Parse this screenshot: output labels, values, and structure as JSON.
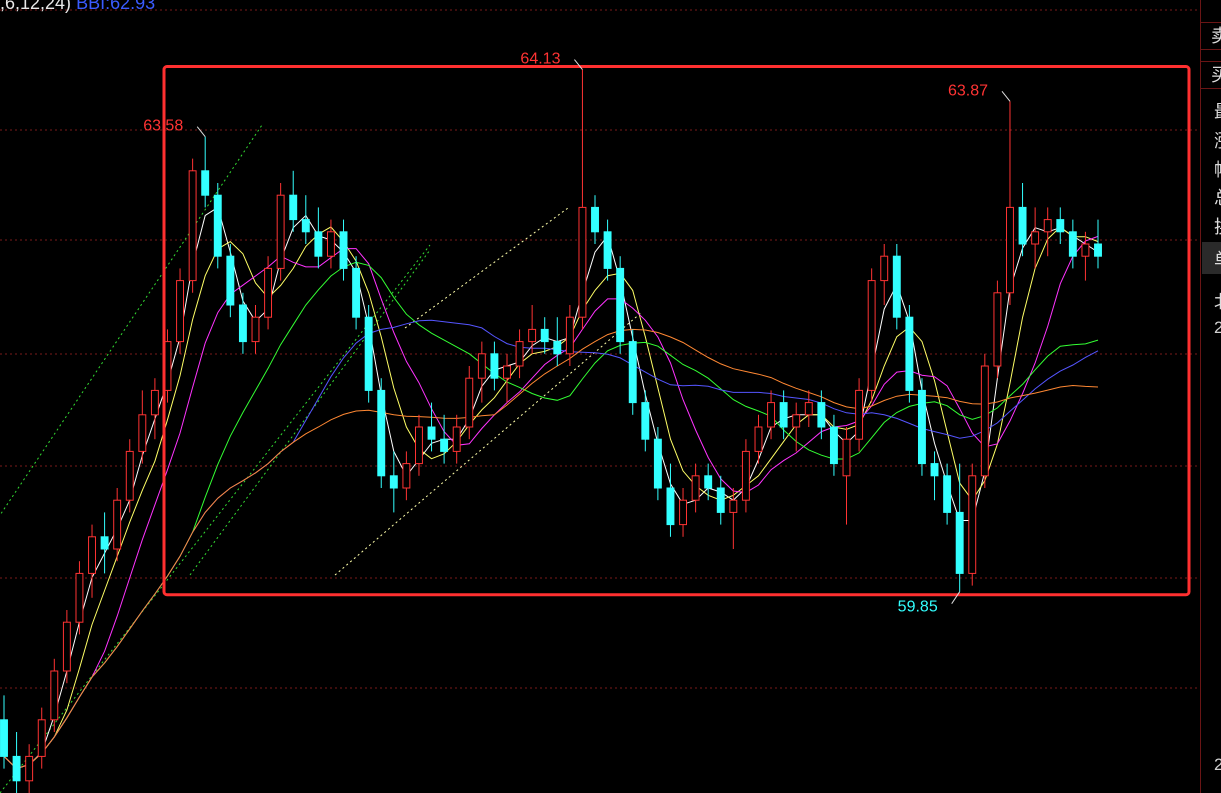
{
  "header": {
    "params_text": ",6,12,24)",
    "bbi_text": "BBI:62.93"
  },
  "colors": {
    "background": "#000000",
    "up": "#ff3333",
    "down": "#33ffff",
    "ma_white": "#ffffff",
    "ma_yellow": "#ffff66",
    "ma_magenta": "#ff33ff",
    "ma_green": "#33ff33",
    "ma_blue": "#5555ff",
    "ma_orange": "#ff8833",
    "highlight_box": "#ff3030",
    "grid": "#7a1a1a"
  },
  "right_panel": {
    "row_chars": [
      "卖",
      "买"
    ],
    "chars": [
      "最",
      "涨",
      "幅",
      "总",
      "换"
    ],
    "dark_char": "单",
    "label_char": "北",
    "numbers": [
      "2",
      "2"
    ]
  },
  "chart_data": {
    "type": "candlestick",
    "price_axis_range": [
      58.2,
      64.7
    ],
    "grid": "horizontal dashed",
    "annotations": [
      {
        "label": "63.58",
        "kind": "local high"
      },
      {
        "label": "64.13",
        "kind": "range high"
      },
      {
        "label": "63.87",
        "kind": "local high"
      },
      {
        "label": "59.85",
        "kind": "range low"
      }
    ],
    "highlight_range": {
      "high": 64.13,
      "low": 59.85
    },
    "ohlc": [
      [
        58.8,
        59.0,
        58.4,
        58.5
      ],
      [
        58.5,
        58.7,
        58.2,
        58.3
      ],
      [
        58.3,
        58.6,
        58.2,
        58.5
      ],
      [
        58.5,
        58.9,
        58.4,
        58.8
      ],
      [
        58.8,
        59.3,
        58.7,
        59.2
      ],
      [
        59.2,
        59.7,
        59.1,
        59.6
      ],
      [
        59.6,
        60.1,
        59.5,
        60.0
      ],
      [
        60.0,
        60.4,
        59.8,
        60.3
      ],
      [
        60.3,
        60.5,
        60.0,
        60.2
      ],
      [
        60.2,
        60.7,
        60.1,
        60.6
      ],
      [
        60.6,
        61.1,
        60.5,
        61.0
      ],
      [
        61.0,
        61.5,
        60.9,
        61.3
      ],
      [
        61.3,
        61.6,
        61.1,
        61.5
      ],
      [
        61.5,
        62.0,
        61.4,
        61.9
      ],
      [
        61.9,
        62.5,
        61.8,
        62.4
      ],
      [
        62.4,
        63.4,
        62.3,
        63.3
      ],
      [
        63.3,
        63.58,
        63.0,
        63.1
      ],
      [
        63.1,
        63.2,
        62.5,
        62.6
      ],
      [
        62.6,
        62.7,
        62.1,
        62.2
      ],
      [
        62.2,
        62.3,
        61.8,
        61.9
      ],
      [
        61.9,
        62.2,
        61.8,
        62.1
      ],
      [
        62.1,
        62.6,
        62.0,
        62.5
      ],
      [
        62.5,
        63.2,
        62.4,
        63.1
      ],
      [
        63.1,
        63.3,
        62.8,
        62.9
      ],
      [
        62.9,
        63.1,
        62.7,
        62.8
      ],
      [
        62.8,
        63.0,
        62.5,
        62.6
      ],
      [
        62.6,
        62.9,
        62.5,
        62.8
      ],
      [
        62.8,
        62.9,
        62.4,
        62.5
      ],
      [
        62.5,
        62.6,
        62.0,
        62.1
      ],
      [
        62.1,
        62.2,
        61.4,
        61.5
      ],
      [
        61.5,
        61.6,
        60.7,
        60.8
      ],
      [
        60.8,
        61.0,
        60.5,
        60.7
      ],
      [
        60.7,
        61.0,
        60.6,
        60.9
      ],
      [
        60.9,
        61.3,
        60.8,
        61.2
      ],
      [
        61.2,
        61.4,
        61.0,
        61.1
      ],
      [
        61.1,
        61.3,
        60.9,
        61.0
      ],
      [
        61.0,
        61.3,
        60.9,
        61.2
      ],
      [
        61.2,
        61.7,
        61.1,
        61.6
      ],
      [
        61.6,
        61.9,
        61.4,
        61.8
      ],
      [
        61.8,
        61.9,
        61.5,
        61.6
      ],
      [
        61.6,
        61.8,
        61.4,
        61.7
      ],
      [
        61.7,
        62.0,
        61.6,
        61.9
      ],
      [
        61.9,
        62.2,
        61.8,
        62.0
      ],
      [
        62.0,
        62.1,
        61.8,
        61.9
      ],
      [
        61.9,
        62.1,
        61.7,
        61.8
      ],
      [
        61.8,
        62.2,
        61.7,
        62.1
      ],
      [
        62.1,
        64.13,
        62.0,
        63.0
      ],
      [
        63.0,
        63.1,
        62.7,
        62.8
      ],
      [
        62.8,
        62.9,
        62.4,
        62.5
      ],
      [
        62.5,
        62.6,
        61.8,
        61.9
      ],
      [
        61.9,
        62.0,
        61.3,
        61.4
      ],
      [
        61.4,
        61.5,
        61.0,
        61.1
      ],
      [
        61.1,
        61.2,
        60.6,
        60.7
      ],
      [
        60.7,
        60.9,
        60.3,
        60.4
      ],
      [
        60.4,
        60.7,
        60.3,
        60.6
      ],
      [
        60.6,
        60.9,
        60.5,
        60.8
      ],
      [
        60.8,
        60.9,
        60.6,
        60.7
      ],
      [
        60.7,
        60.8,
        60.4,
        60.5
      ],
      [
        60.5,
        60.7,
        60.2,
        60.6
      ],
      [
        60.6,
        61.1,
        60.5,
        61.0
      ],
      [
        61.0,
        61.3,
        60.9,
        61.2
      ],
      [
        61.2,
        61.5,
        61.1,
        61.4
      ],
      [
        61.4,
        61.5,
        61.1,
        61.2
      ],
      [
        61.2,
        61.4,
        61.0,
        61.3
      ],
      [
        61.3,
        61.5,
        61.2,
        61.4
      ],
      [
        61.4,
        61.5,
        61.1,
        61.2
      ],
      [
        61.2,
        61.3,
        60.8,
        60.9
      ],
      [
        60.8,
        61.2,
        60.4,
        61.1
      ],
      [
        61.1,
        61.6,
        61.0,
        61.5
      ],
      [
        61.5,
        62.5,
        61.4,
        62.4
      ],
      [
        62.4,
        62.7,
        62.2,
        62.6
      ],
      [
        62.6,
        62.7,
        62.0,
        62.1
      ],
      [
        62.1,
        62.2,
        61.4,
        61.5
      ],
      [
        61.5,
        61.6,
        60.8,
        60.9
      ],
      [
        60.9,
        61.0,
        60.6,
        60.8
      ],
      [
        60.8,
        60.9,
        60.4,
        60.5
      ],
      [
        60.5,
        60.9,
        59.85,
        60.0
      ],
      [
        60.0,
        60.9,
        59.9,
        60.8
      ],
      [
        60.8,
        61.8,
        60.7,
        61.7
      ],
      [
        61.7,
        62.4,
        61.6,
        62.3
      ],
      [
        62.3,
        63.87,
        62.2,
        63.0
      ],
      [
        63.0,
        63.2,
        62.6,
        62.7
      ],
      [
        62.7,
        63.0,
        62.5,
        62.8
      ],
      [
        62.8,
        63.0,
        62.6,
        62.9
      ],
      [
        62.9,
        63.0,
        62.7,
        62.8
      ],
      [
        62.8,
        62.9,
        62.5,
        62.6
      ],
      [
        62.6,
        62.8,
        62.4,
        62.7
      ],
      [
        62.7,
        62.9,
        62.5,
        62.6
      ]
    ]
  }
}
